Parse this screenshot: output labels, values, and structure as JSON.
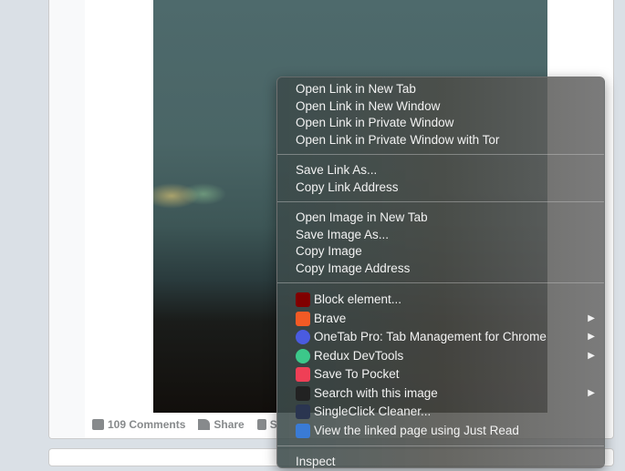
{
  "post": {
    "comments": "109 Comments",
    "share": "Share",
    "save": "S"
  },
  "menu": {
    "group1": [
      "Open Link in New Tab",
      "Open Link in New Window",
      "Open Link in Private Window",
      "Open Link in Private Window with Tor"
    ],
    "group2": [
      "Save Link As...",
      "Copy Link Address"
    ],
    "group3": [
      "Open Image in New Tab",
      "Save Image As...",
      "Copy Image",
      "Copy Image Address"
    ],
    "extensions": [
      {
        "label": "Block element...",
        "icon": "ublock-icon",
        "color": "#800000",
        "submenu": false
      },
      {
        "label": "Brave",
        "icon": "brave-icon",
        "color": "#f25a25",
        "submenu": true
      },
      {
        "label": "OneTab Pro: Tab Management for Chrome",
        "icon": "onetab-icon",
        "color": "#4a5be0",
        "submenu": true
      },
      {
        "label": "Redux DevTools",
        "icon": "redux-icon",
        "color": "#3cc88a",
        "submenu": true
      },
      {
        "label": "Save To Pocket",
        "icon": "pocket-icon",
        "color": "#ef3f56",
        "submenu": false
      },
      {
        "label": "Search with this image",
        "icon": "image-search-icon",
        "color": "#222222",
        "submenu": true
      },
      {
        "label": "SingleClick Cleaner...",
        "icon": "trash-icon",
        "color": "#2a3550",
        "submenu": false
      },
      {
        "label": "View the linked page using Just Read",
        "icon": "just-read-icon",
        "color": "#3a7bd5",
        "submenu": false
      }
    ],
    "inspect": "Inspect",
    "submenu_arrow": "▶"
  }
}
